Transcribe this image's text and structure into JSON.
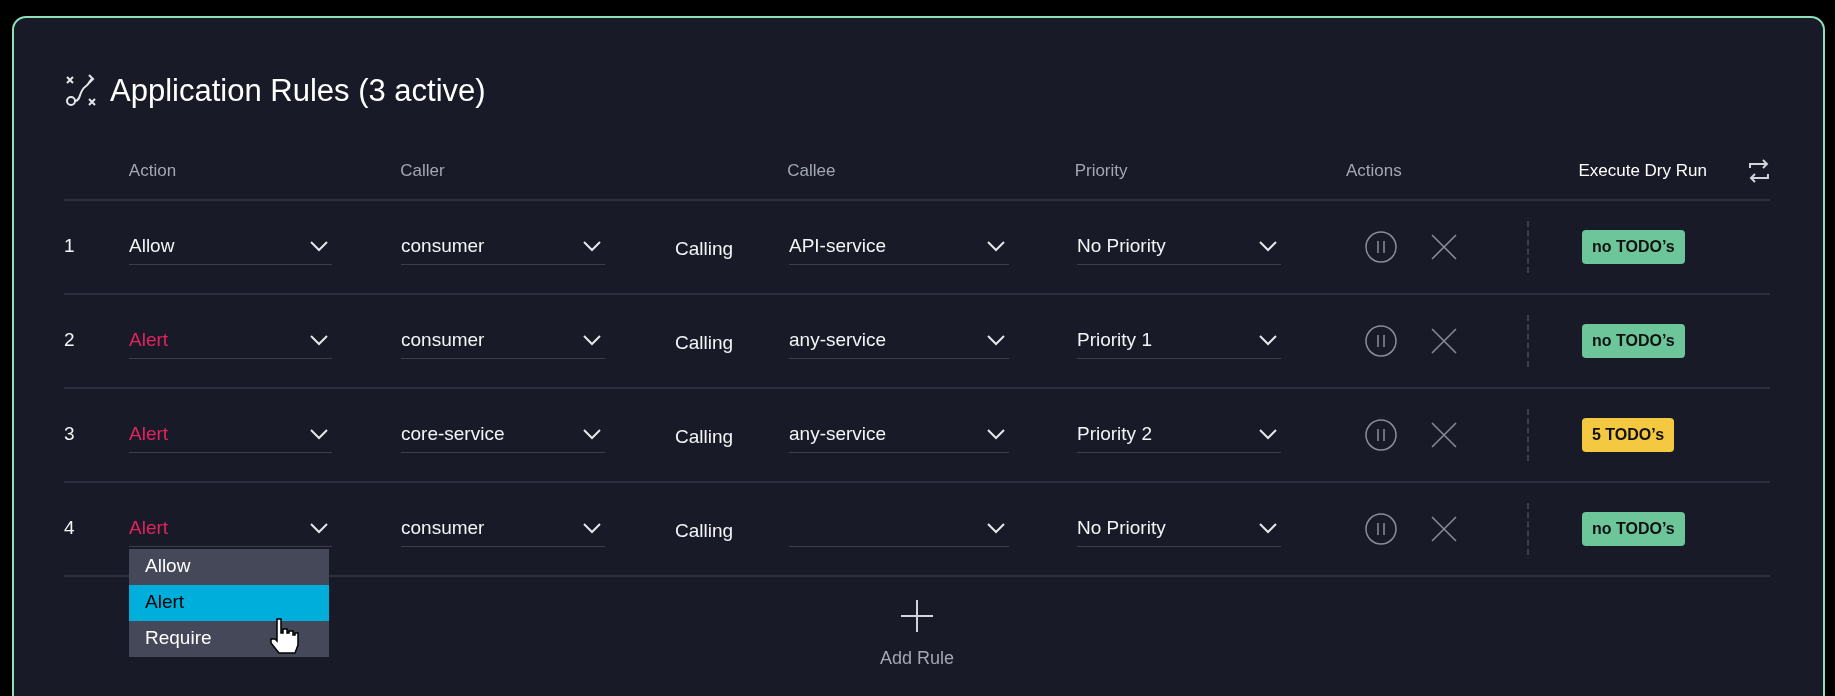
{
  "title": "Application Rules (3 active)",
  "columns": [
    "Action",
    "Caller",
    "Callee",
    "Priority",
    "Actions",
    "Execute Dry Run"
  ],
  "rows": [
    {
      "number": "1",
      "action": {
        "value": "Allow",
        "kind": "allow"
      },
      "caller": "consumer",
      "relation": "Calling",
      "callee": "API-service",
      "priority": "No Priority",
      "status": {
        "text": "no TODO’s",
        "kind": "ok"
      }
    },
    {
      "number": "2",
      "action": {
        "value": "Alert",
        "kind": "alert"
      },
      "caller": "consumer",
      "relation": "Calling",
      "callee": "any-service",
      "priority": "Priority 1",
      "status": {
        "text": "no TODO’s",
        "kind": "ok"
      }
    },
    {
      "number": "3",
      "action": {
        "value": "Alert",
        "kind": "alert"
      },
      "caller": "core-service",
      "relation": "Calling",
      "callee": "any-service",
      "priority": "Priority 2",
      "status": {
        "text": "5 TODO’s",
        "kind": "warning"
      }
    },
    {
      "number": "4",
      "action": {
        "value": "Alert",
        "kind": "alert",
        "expanded": true,
        "options": [
          {
            "label": "Allow",
            "selected": false
          },
          {
            "label": "Alert",
            "selected": true
          },
          {
            "label": "Require",
            "selected": false
          }
        ]
      },
      "caller": "consumer",
      "relation": "Calling",
      "priority": "No Priority",
      "status": {
        "text": "no TODO’s",
        "kind": "ok"
      }
    }
  ],
  "add_rule": "Add Rule"
}
